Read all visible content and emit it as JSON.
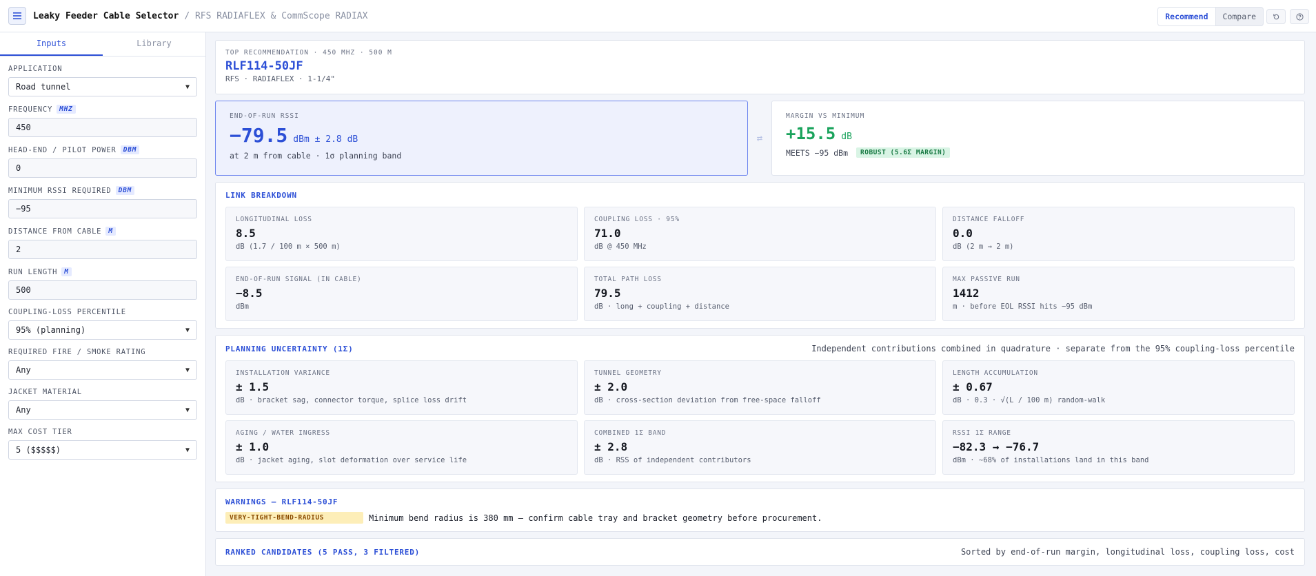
{
  "header": {
    "title": "Leaky Feeder Cable Selector",
    "subtitle": "/ RFS RADIAFLEX & CommScope RADIAX",
    "modes": [
      "Recommend",
      "Compare"
    ],
    "active_mode": "Recommend"
  },
  "sidebar": {
    "tabs": [
      "Inputs",
      "Library"
    ],
    "active_tab": "Inputs",
    "fields": {
      "application": {
        "label": "APPLICATION",
        "value": "Road tunnel"
      },
      "frequency": {
        "label": "FREQUENCY",
        "unit": "MHZ",
        "value": "450"
      },
      "pilot_power": {
        "label": "HEAD-END / PILOT POWER",
        "unit": "DBM",
        "value": "0"
      },
      "min_rssi": {
        "label": "MINIMUM RSSI REQUIRED",
        "unit": "DBM",
        "value": "−95"
      },
      "distance": {
        "label": "DISTANCE FROM CABLE",
        "unit": "M",
        "value": "2"
      },
      "run_length": {
        "label": "RUN LENGTH",
        "unit": "M",
        "value": "500"
      },
      "percentile": {
        "label": "COUPLING-LOSS PERCENTILE",
        "value": "95% (planning)"
      },
      "fire_rating": {
        "label": "REQUIRED FIRE / SMOKE RATING",
        "value": "Any"
      },
      "jacket": {
        "label": "JACKET MATERIAL",
        "value": "Any"
      },
      "cost_tier": {
        "label": "MAX COST TIER",
        "value": "5 ($$$$$)"
      }
    }
  },
  "top": {
    "kicker": "TOP RECOMMENDATION · 450 MHZ · 500 M",
    "name": "RLF114-50JF",
    "meta": "RFS · RADIAFLEX · 1-1/4\""
  },
  "rssi": {
    "kicker": "END-OF-RUN RSSI",
    "value": "−79.5",
    "unit": "dBm ± 2.8 dB",
    "sub": "at 2 m from cable · 1σ planning band"
  },
  "margin": {
    "kicker": "MARGIN VS MINIMUM",
    "value": "+15.5",
    "unit": "dB",
    "sub": "MEETS −95 dBm",
    "badge": "ROBUST (5.6Σ MARGIN)"
  },
  "link": {
    "title": "LINK BREAKDOWN",
    "items": [
      {
        "label": "LONGITUDINAL LOSS",
        "value": "8.5",
        "sub": "dB (1.7 / 100 m × 500 m)"
      },
      {
        "label": "COUPLING LOSS · 95%",
        "value": "71.0",
        "sub": "dB @ 450 MHz"
      },
      {
        "label": "DISTANCE FALLOFF",
        "value": "0.0",
        "sub": "dB (2 m → 2 m)"
      },
      {
        "label": "END-OF-RUN SIGNAL (IN CABLE)",
        "value": "−8.5",
        "sub": "dBm"
      },
      {
        "label": "TOTAL PATH LOSS",
        "value": "79.5",
        "sub": "dB · long + coupling + distance"
      },
      {
        "label": "MAX PASSIVE RUN",
        "value": "1412",
        "sub": "m · before EOL RSSI hits −95 dBm"
      }
    ]
  },
  "uncertainty": {
    "title": "PLANNING UNCERTAINTY (1Σ)",
    "note": "Independent contributions combined in quadrature · separate from the 95% coupling-loss percentile",
    "items": [
      {
        "label": "INSTALLATION VARIANCE",
        "value": "± 1.5",
        "sub": "dB · bracket sag, connector torque, splice loss drift"
      },
      {
        "label": "TUNNEL GEOMETRY",
        "value": "± 2.0",
        "sub": "dB · cross-section deviation from free-space falloff"
      },
      {
        "label": "LENGTH ACCUMULATION",
        "value": "± 0.67",
        "sub": "dB · 0.3 · √(L / 100 m) random-walk"
      },
      {
        "label": "AGING / WATER INGRESS",
        "value": "± 1.0",
        "sub": "dB · jacket aging, slot deformation over service life"
      },
      {
        "label": "COMBINED 1Σ BAND",
        "value": "± 2.8",
        "sub": "dB · RSS of independent contributors"
      },
      {
        "label": "RSSI 1Σ RANGE",
        "value": "−82.3 → −76.7",
        "sub": "dBm · ~68% of installations land in this band"
      }
    ]
  },
  "warnings": {
    "title": "WARNINGS — RLF114-50JF",
    "badge": "VERY-TIGHT-BEND-RADIUS",
    "text": "Minimum bend radius is 380 mm — confirm cable tray and bracket geometry before procurement."
  },
  "ranked": {
    "title": "RANKED CANDIDATES (5 PASS, 3 FILTERED)",
    "note": "Sorted by end-of-run margin, longitudinal loss, coupling loss, cost"
  },
  "colors": {
    "accent": "#2c4fd6",
    "positive": "#1aa35c",
    "warning": "#fdeeb8"
  },
  "icons": {
    "menu": "hamburger-icon",
    "reset": "reset-icon",
    "help": "help-icon",
    "swap": "swap-icon"
  }
}
